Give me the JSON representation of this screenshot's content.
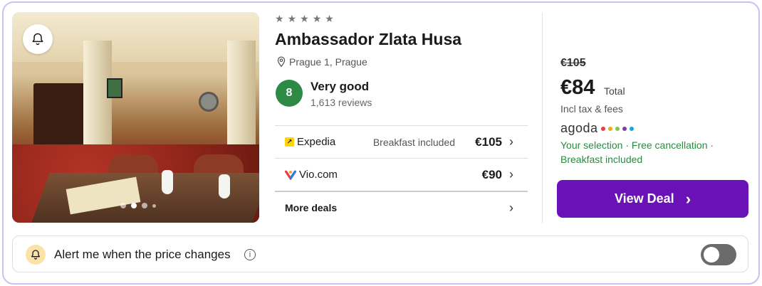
{
  "hotel": {
    "stars": 5,
    "name": "Ambassador Zlata Husa",
    "location": "Prague 1, Prague",
    "rating_score": "8",
    "rating_label": "Very good",
    "reviews": "1,613 reviews"
  },
  "photo": {
    "carousel_dots": 4,
    "active_dot": 2
  },
  "deals": [
    {
      "provider": "Expedia",
      "logo": "expedia-arrow-icon",
      "note": "Breakfast included",
      "price": "€105"
    },
    {
      "provider": "Vio.com",
      "logo": "vio-heart-icon",
      "note": "",
      "price": "€90"
    }
  ],
  "more_deals_label": "More deals",
  "offer": {
    "old_price": "€105",
    "price": "€84",
    "price_suffix": "Total",
    "tax_note": "Incl tax & fees",
    "partner": "agoda",
    "partner_dot_colors": [
      "#e8403f",
      "#f6a821",
      "#8bc34a",
      "#7b3fa0",
      "#1aa5d8"
    ],
    "perks": "Your selection · Free cancellation · Breakfast included",
    "cta_label": "View Deal"
  },
  "alert": {
    "label": "Alert me when the price changes",
    "toggle_on": false
  },
  "colors": {
    "accent": "#6a11b8",
    "rating_green": "#2c8a45",
    "perk_green": "#2a8a3e",
    "card_border": "#c9c2f0"
  }
}
